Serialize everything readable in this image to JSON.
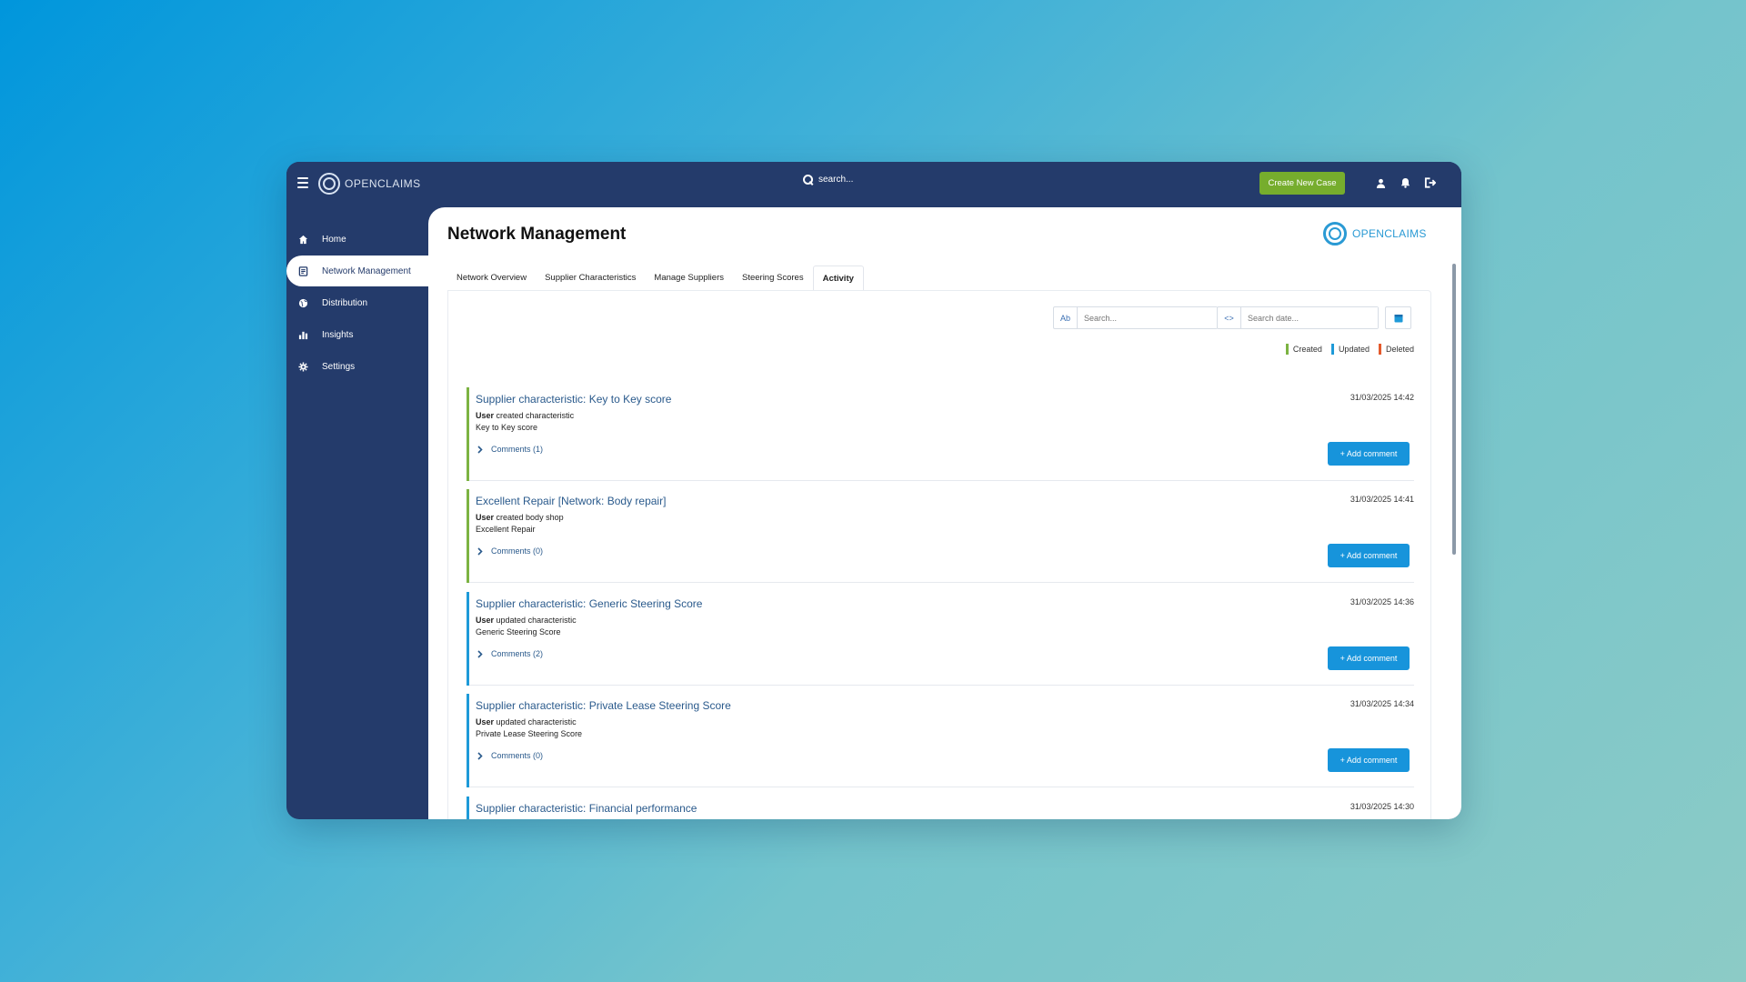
{
  "app": {
    "logo_text": "OPENCLAIMS",
    "search_placeholder": "search...",
    "create_button": "Create New Case"
  },
  "sidebar": {
    "items": [
      {
        "label": "Home",
        "icon": "home-icon"
      },
      {
        "label": "Network Management",
        "icon": "document-icon"
      },
      {
        "label": "Distribution",
        "icon": "globe-icon"
      },
      {
        "label": "Insights",
        "icon": "bar-chart-icon"
      },
      {
        "label": "Settings",
        "icon": "gear-icon"
      }
    ],
    "active_index": 1
  },
  "page": {
    "title": "Network Management",
    "brand_text": "OPENCLAIMS"
  },
  "tabs": [
    {
      "label": "Network Overview"
    },
    {
      "label": "Supplier Characteristics"
    },
    {
      "label": "Manage Suppliers"
    },
    {
      "label": "Steering Scores"
    },
    {
      "label": "Activity"
    }
  ],
  "active_tab": 4,
  "filters": {
    "search_placeholder": "Search...",
    "date_placeholder": "Search date...",
    "text_icon": "Ab",
    "code_icon": "<>"
  },
  "legend": [
    {
      "label": "Created",
      "color": "#7cb342"
    },
    {
      "label": "Updated",
      "color": "#1e9ad8"
    },
    {
      "label": "Deleted",
      "color": "#e45a2c"
    }
  ],
  "activities": [
    {
      "title": "Supplier characteristic: Key to Key score",
      "date": "31/03/2025 14:42",
      "user": "User",
      "action": "created characteristic",
      "detail": "Key to Key score",
      "comments": "Comments (1)",
      "add_comment": "+ Add comment",
      "color": "#7cb342"
    },
    {
      "title": "Excellent Repair [Network: Body repair]",
      "date": "31/03/2025 14:41",
      "user": "User",
      "action": "created body shop",
      "detail": "Excellent Repair",
      "comments": "Comments (0)",
      "add_comment": "+ Add comment",
      "color": "#7cb342"
    },
    {
      "title": "Supplier characteristic: Generic Steering Score",
      "date": "31/03/2025 14:36",
      "user": "User",
      "action": "updated characteristic",
      "detail": "Generic Steering Score",
      "comments": "Comments (2)",
      "add_comment": "+ Add comment",
      "color": "#1e9ad8"
    },
    {
      "title": "Supplier characteristic: Private Lease Steering Score",
      "date": "31/03/2025 14:34",
      "user": "User",
      "action": "updated characteristic",
      "detail": "Private Lease Steering Score",
      "comments": "Comments (0)",
      "add_comment": "+ Add comment",
      "color": "#1e9ad8"
    },
    {
      "title": "Supplier characteristic: Financial performance",
      "date": "31/03/2025 14:30",
      "user": "",
      "action": "",
      "detail": "",
      "comments": "",
      "add_comment": "",
      "color": "#1e9ad8"
    }
  ]
}
